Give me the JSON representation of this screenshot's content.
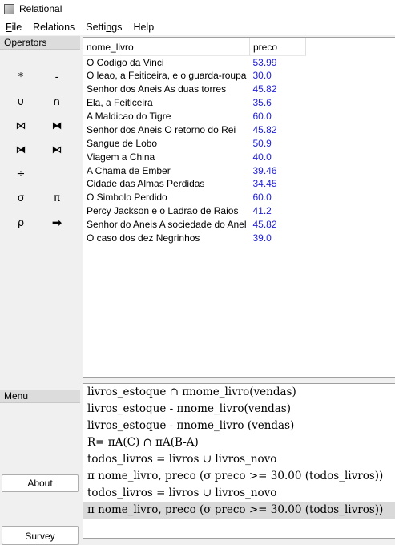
{
  "window": {
    "title": "Relational"
  },
  "menu": [
    {
      "label": "File",
      "accel": "F",
      "rest": "ile"
    },
    {
      "label": "Relations",
      "accel": "",
      "rest": "Relations"
    },
    {
      "label": "Settings",
      "pre": "Setti",
      "accel": "n",
      "rest": "gs"
    },
    {
      "label": "Help",
      "accel": "",
      "rest": "Help"
    }
  ],
  "operators": {
    "header": "Operators",
    "items": [
      {
        "symbol": "*",
        "name": "product"
      },
      {
        "symbol": "-",
        "name": "difference"
      },
      {
        "symbol": "∪",
        "name": "union"
      },
      {
        "symbol": "∩",
        "name": "intersection"
      },
      {
        "symbol": "⋈",
        "name": "natural-join"
      },
      {
        "symbol": "⧓",
        "name": "outer-join"
      },
      {
        "symbol": "⧒",
        "name": "left-join"
      },
      {
        "symbol": "⧑",
        "name": "right-join"
      },
      {
        "symbol": "÷",
        "name": "division"
      },
      {
        "symbol": "σ",
        "name": "selection"
      },
      {
        "symbol": "π",
        "name": "projection"
      },
      {
        "symbol": "ρ",
        "name": "rename"
      },
      {
        "symbol": "➡",
        "name": "arrow"
      }
    ]
  },
  "side_menu": {
    "header": "Menu",
    "about": "About",
    "survey": "Survey"
  },
  "table": {
    "columns": [
      "nome_livro",
      "preco"
    ],
    "rows": [
      [
        "O Codigo da Vinci",
        "53.99"
      ],
      [
        "O leao, a Feiticeira, e o guarda-roupa",
        "30.0"
      ],
      [
        "Senhor dos Aneis As duas torres",
        "45.82"
      ],
      [
        "Ela, a Feiticeira",
        "35.6"
      ],
      [
        "A Maldicao do Tigre",
        "60.0"
      ],
      [
        "Senhor dos Aneis O retorno do Rei",
        "45.82"
      ],
      [
        "Sangue de Lobo",
        "50.9"
      ],
      [
        "Viagem a China",
        "40.0"
      ],
      [
        "A Chama de Ember",
        "39.46"
      ],
      [
        "Cidade das Almas Perdidas",
        "34.45"
      ],
      [
        "O Simbolo Perdido",
        "60.0"
      ],
      [
        "Percy Jackson e o Ladrao de Raios",
        "41.2"
      ],
      [
        "Senhor do Aneis A sociedade do Anel",
        "45.82"
      ],
      [
        "O caso dos dez Negrinhos",
        "39.0"
      ]
    ]
  },
  "history": {
    "selected_index": 7,
    "queries": [
      "livros_estoque ∩ πnome_livro(vendas)",
      "livros_estoque - πnome_livro(vendas)",
      "livros_estoque - πnome_livro (vendas)",
      "R= πA(C) ∩ πA(B-A)",
      "todos_livros = livros ∪ livros_novo",
      "π nome_livro, preco (σ preco >= 30.00 (todos_livros))",
      "todos_livros = livros ∪ livros_novo",
      "π nome_livro, preco (σ preco >= 30.00 (todos_livros))"
    ]
  }
}
